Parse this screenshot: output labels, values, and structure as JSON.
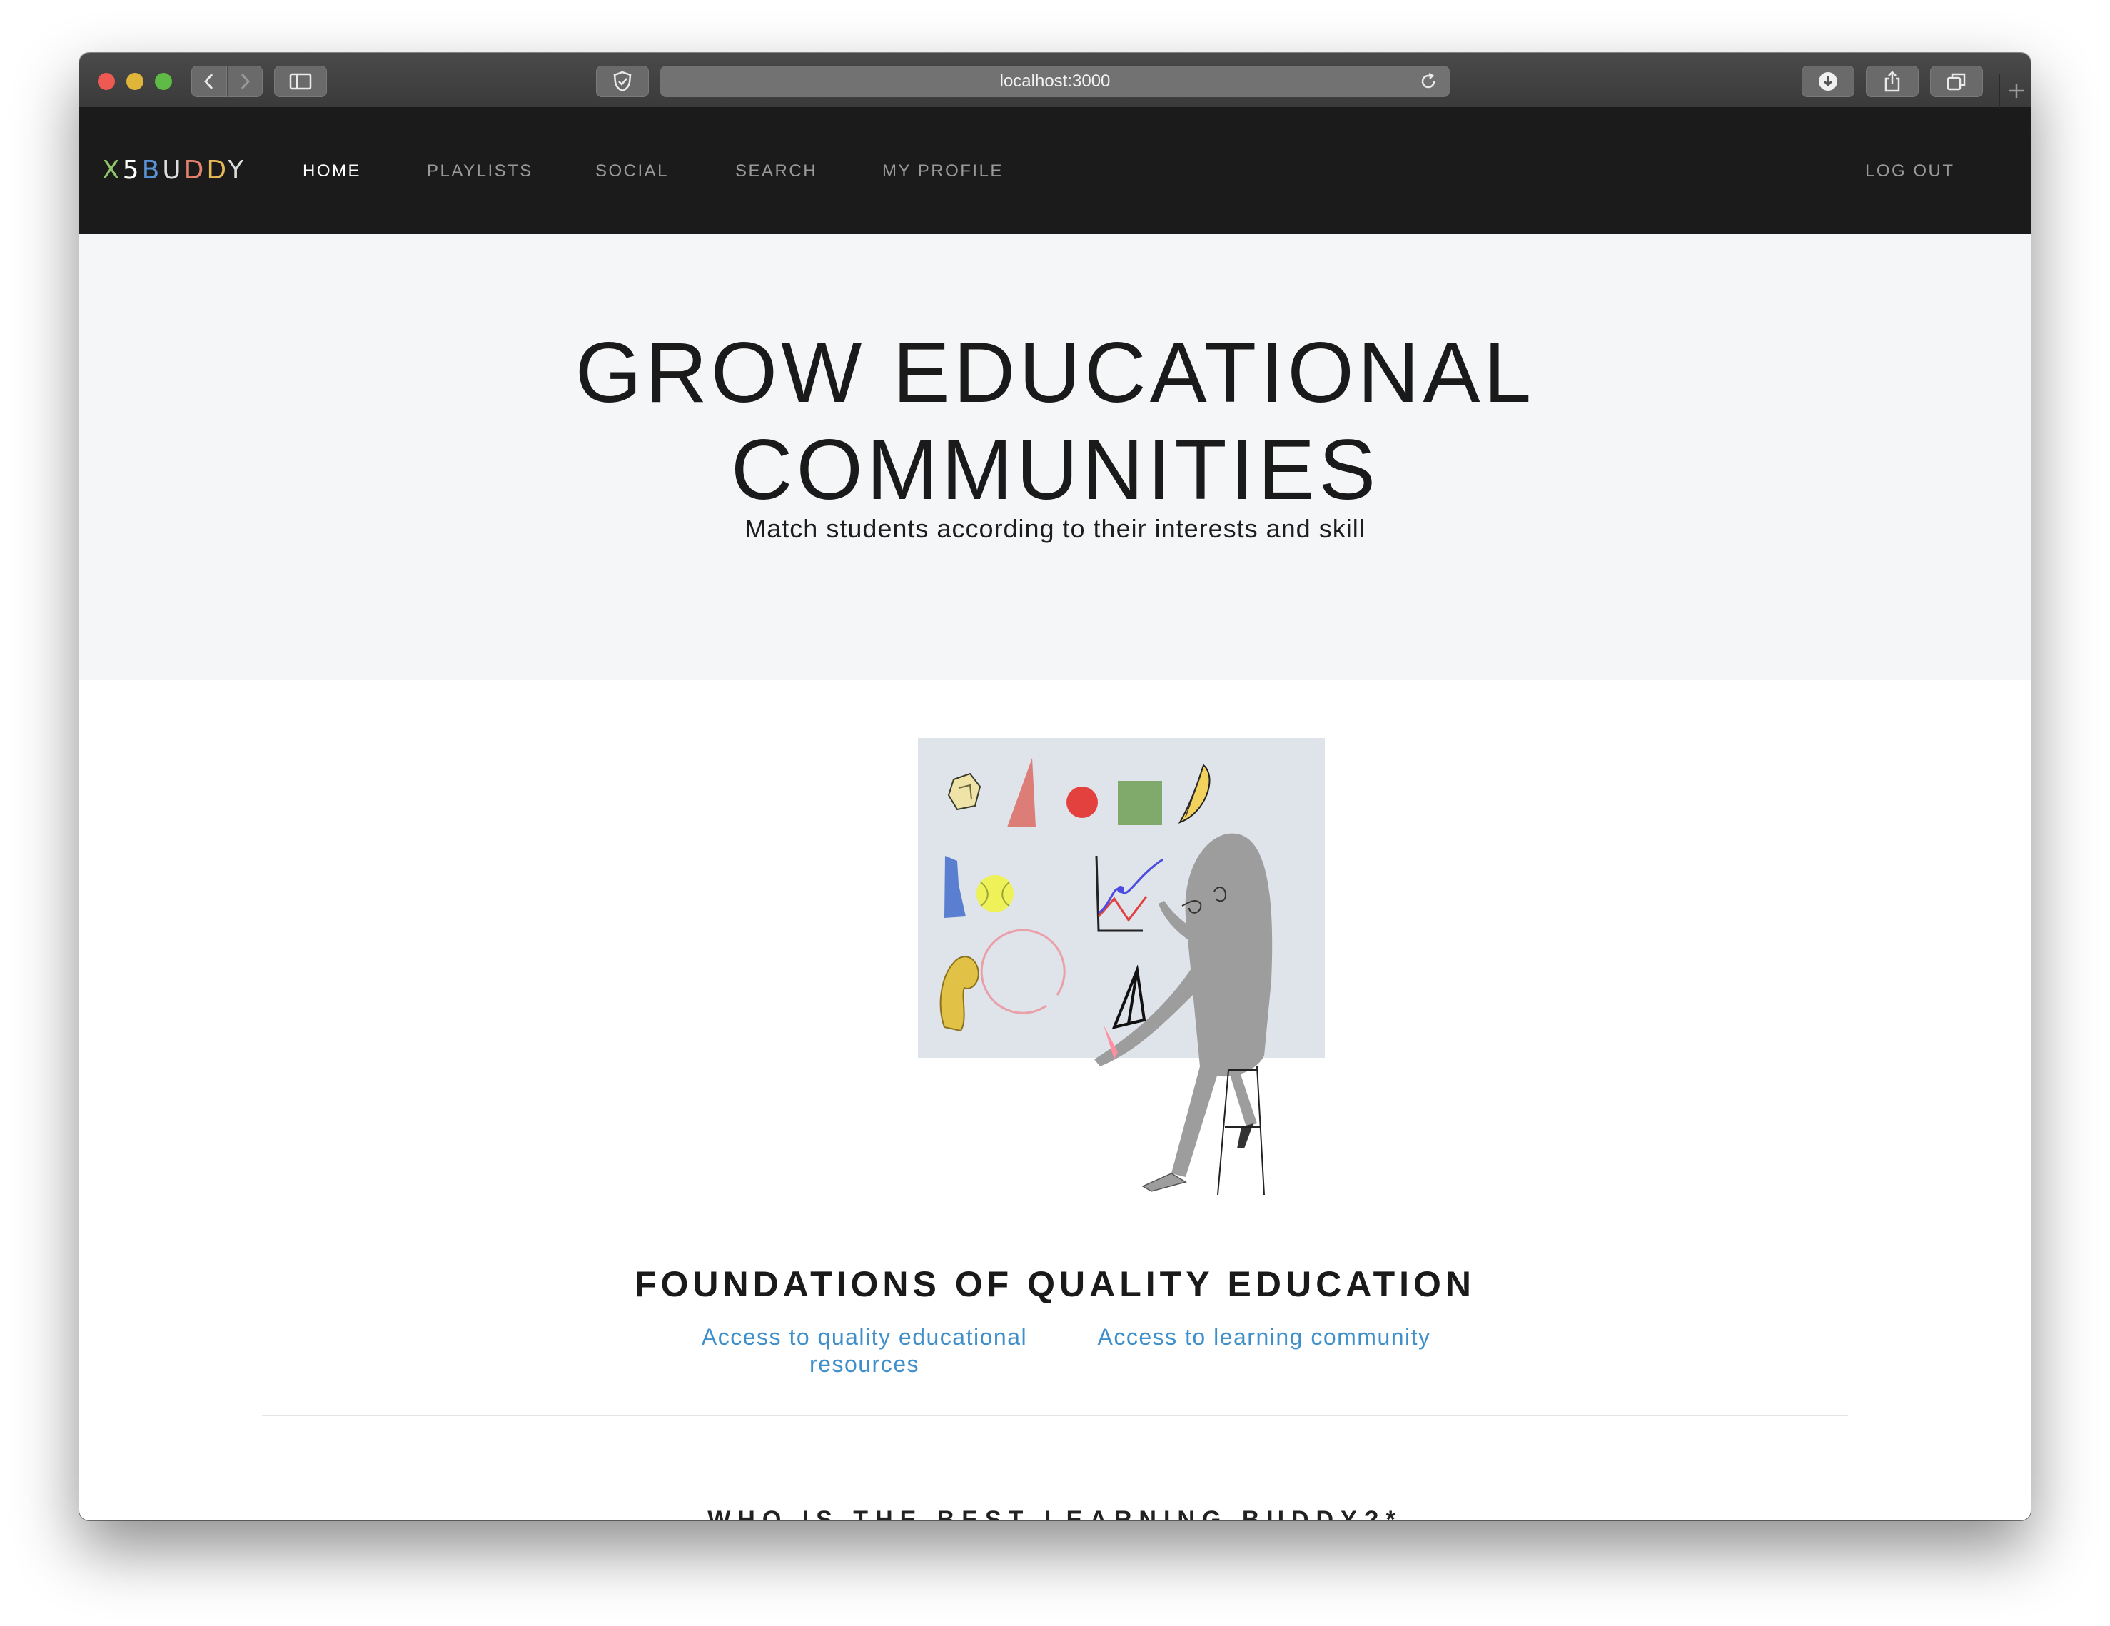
{
  "browser": {
    "url": "localhost:3000"
  },
  "header": {
    "logo_letters": [
      {
        "char": "X",
        "color": "#8fc46a"
      },
      {
        "char": "5",
        "color": "#ffffff"
      },
      {
        "char": "B",
        "color": "#5a92d6"
      },
      {
        "char": "U",
        "color": "#dddddd"
      },
      {
        "char": "D",
        "color": "#e2826e"
      },
      {
        "char": "D",
        "color": "#e6b856"
      },
      {
        "char": "Y",
        "color": "#dddddd"
      }
    ],
    "nav": {
      "home": "HOME",
      "playlists": "PLAYLISTS",
      "social": "SOCIAL",
      "search": "SEARCH",
      "my_profile": "MY PROFILE"
    },
    "logout": "LOG OUT"
  },
  "hero": {
    "title_line1": "GROW EDUCATIONAL",
    "title_line2": "COMMUNITIES",
    "subtitle": "Match students according to their interests and skill"
  },
  "foundations": {
    "title": "FOUNDATIONS OF QUALITY EDUCATION",
    "link1_line1": "Access to quality educational",
    "link1_line2": "resources",
    "link2": "Access to learning community"
  },
  "next_section": {
    "heading": "WHO IS THE BEST LEARNING BUDDY?*"
  },
  "colors": {
    "header_bg": "#1b1b1b",
    "hero_bg": "#f5f6f8",
    "link": "#3f8fcb"
  }
}
